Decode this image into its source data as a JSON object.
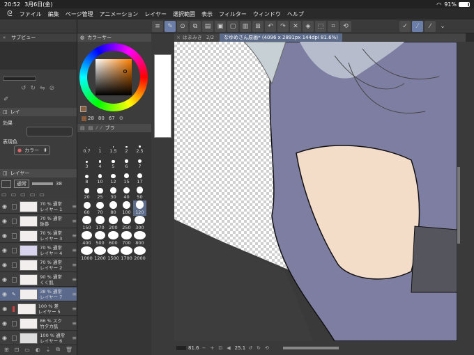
{
  "status": {
    "time": "20:52",
    "date": "3月6日(金)",
    "battery": "91%"
  },
  "menu": [
    "ファイル",
    "編集",
    "ページ管理",
    "アニメーション",
    "レイヤー",
    "選択範囲",
    "表示",
    "フィルター",
    "ウィンドウ",
    "ヘルプ"
  ],
  "subview": {
    "tab": "サブビュー"
  },
  "color": {
    "tab": "カラーサー",
    "values": {
      "a": "28",
      "b": "80",
      "c": "67"
    }
  },
  "effects": {
    "tab": "レイ",
    "label": "効果",
    "color_label": "表現色",
    "color_value": "カラー"
  },
  "layers": {
    "tab": "レイヤー",
    "blend": "通常",
    "opacity": "38",
    "items": [
      {
        "pct": "70 %",
        "mode": "通常",
        "name": "レイヤー 1"
      },
      {
        "pct": "70 %",
        "mode": "通常",
        "name": "鉢巻"
      },
      {
        "pct": "70 %",
        "mode": "通常",
        "name": "レイヤー 3"
      },
      {
        "pct": "70 %",
        "mode": "通常",
        "name": "レイヤー 4"
      },
      {
        "pct": "70 %",
        "mode": "通常",
        "name": "レイヤー 2"
      },
      {
        "pct": "90 %",
        "mode": "通常",
        "name": "くく肌"
      },
      {
        "pct": "38 %",
        "mode": "通常",
        "name": "レイヤー 7"
      },
      {
        "pct": "100 %",
        "mode": "差",
        "name": "レイヤー 5"
      },
      {
        "pct": "86 %",
        "mode": "スク",
        "name": "竹夕カ肌"
      },
      {
        "pct": "100 %",
        "mode": "通常",
        "name": "レイヤー 6"
      }
    ]
  },
  "brush": {
    "tab": "ブラ",
    "sizes": [
      "0.7",
      "1",
      "1.5",
      "2",
      "2.5",
      "3",
      "4",
      "5",
      "6",
      "7",
      "8",
      "10",
      "12",
      "15",
      "17",
      "20",
      "25",
      "30",
      "40",
      "50",
      "60",
      "70",
      "80",
      "100",
      "120",
      "150",
      "170",
      "200",
      "250",
      "300",
      "400",
      "500",
      "600",
      "700",
      "800",
      "1000",
      "1200",
      "1500",
      "1700",
      "2000"
    ]
  },
  "canvas": {
    "tab1": "はまみき",
    "tab_count": "2/2",
    "tab2": "なゆめさん原画* (4096 x 2891px 144dpi 81.6%)"
  },
  "bottom": {
    "zoom": "81.6",
    "angle": "25.1"
  }
}
